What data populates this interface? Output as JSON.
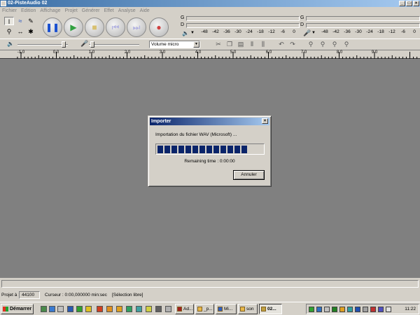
{
  "window": {
    "title": "02-PisteAudio 02",
    "icons": {
      "minimize": "minimize-icon",
      "maximize": "maximize-icon",
      "close": "close-icon"
    }
  },
  "menu": [
    "Fichier",
    "Edition",
    "Affichage",
    "Projet",
    "Générer",
    "Effet",
    "Analyse",
    "Aide"
  ],
  "tools": [
    "selection-tool",
    "envelope-tool",
    "draw-tool",
    "zoom-tool",
    "timeshift-tool",
    "multi-tool"
  ],
  "transport": [
    "pause",
    "play",
    "stop",
    "skip-start",
    "skip-end",
    "record"
  ],
  "meters": {
    "output_letters": [
      "G",
      "D"
    ],
    "input_letters": [
      "G",
      "D"
    ],
    "scale": [
      "-48",
      "-42",
      "-36",
      "-30",
      "-24",
      "-18",
      "-12",
      "-6",
      "0"
    ]
  },
  "mixer": {
    "input_source": "Volume micro"
  },
  "ruler": {
    "labels": [
      "1,0",
      "0,0",
      "1,0",
      "2,0",
      "3,0",
      "4,0",
      "5,0",
      "6,0",
      "7,0",
      "8,0",
      "9,0"
    ],
    "first_negative": true
  },
  "dialog": {
    "title": "Importer",
    "message": "Importation du fichier WAV (Microsoft) ...",
    "progress_blocks_filled": 13,
    "progress_percent": 82,
    "remaining": "Remaining time : 0:00:00",
    "cancel": "Annuler"
  },
  "status": {
    "projet_label": "Projet à :",
    "rate": "44100",
    "cursor": "Curseur : 0:00,000000 min:sec",
    "selection": "[Sélection libre]"
  },
  "taskbar": {
    "start": "Démarrer",
    "tasks": [
      "Ad...",
      "_p...",
      "Mi...",
      "son",
      "02..."
    ],
    "clock": "11:22"
  },
  "colors": {
    "titlebar": "#3a6ea5",
    "dialog_title": "#0a246a",
    "progress": "#0a246a",
    "workspace": "#808080"
  }
}
